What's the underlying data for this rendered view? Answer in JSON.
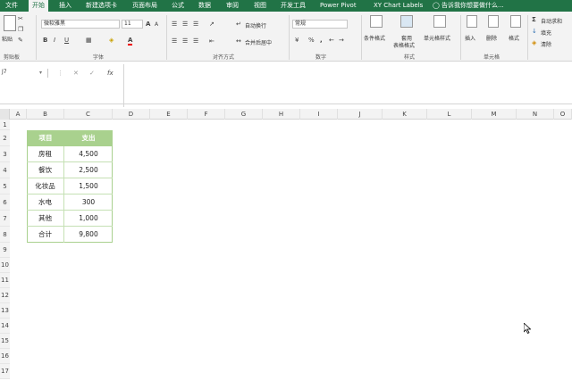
{
  "ribbon_tabs": [
    "文件",
    "开始",
    "插入",
    "新建选项卡",
    "页面布局",
    "公式",
    "数据",
    "审阅",
    "视图",
    "开发工具",
    "Power Pivot",
    "XY Chart Labels"
  ],
  "active_tab": "开始",
  "tell_me": "告诉我你想要做什么...",
  "clipboard": {
    "paste": "粘贴",
    "group": "剪贴板"
  },
  "font": {
    "name": "微软雅黑",
    "size": "11",
    "group": "字体",
    "grow": "A",
    "shrink": "A",
    "bold": "B",
    "italic": "I",
    "underline": "U",
    "color_btn": "A"
  },
  "alignment": {
    "wrap": "自动换行",
    "merge": "合并后居中",
    "group": "对齐方式"
  },
  "number": {
    "format": "常规",
    "currency": "¥",
    "percent": "%",
    "comma": ",",
    "group": "数字"
  },
  "styles": {
    "conditional": "条件格式",
    "table1": "套用",
    "table2": "表格格式",
    "cell": "单元格样式",
    "group": "样式"
  },
  "cells": {
    "insert": "插入",
    "delete": "删除",
    "format": "格式",
    "group": "单元格"
  },
  "editing": {
    "autosum": "自动求和",
    "fill": "填充",
    "clear": "清除"
  },
  "namebox": "J7",
  "fx_label": "fx",
  "columns": [
    "A",
    "B",
    "C",
    "D",
    "E",
    "F",
    "G",
    "H",
    "I",
    "J",
    "K",
    "L",
    "M",
    "N",
    "O"
  ],
  "rows": [
    "1",
    "2",
    "3",
    "4",
    "5",
    "6",
    "7",
    "8",
    "9",
    "10",
    "11",
    "12",
    "13",
    "14",
    "15",
    "16",
    "17"
  ],
  "table": {
    "header": [
      "项目",
      "支出"
    ],
    "rows": [
      [
        "房租",
        "4,500"
      ],
      [
        "餐饮",
        "2,500"
      ],
      [
        "化妆品",
        "1,500"
      ],
      [
        "水电",
        "300"
      ],
      [
        "其他",
        "1,000"
      ],
      [
        "合计",
        "9,800"
      ]
    ]
  },
  "colors": {
    "ribbon": "#217346",
    "header_fill": "#a9d18e"
  }
}
